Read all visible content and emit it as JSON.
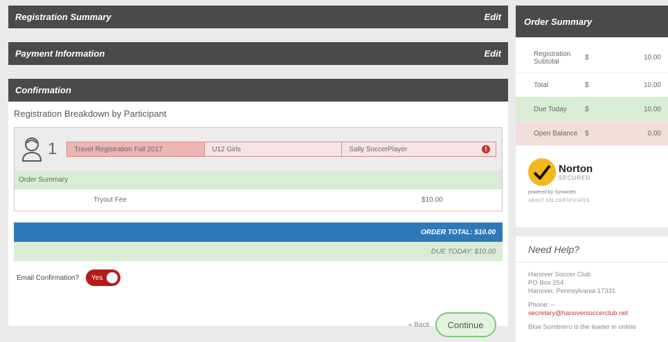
{
  "sections": {
    "registration_summary": "Registration Summary",
    "payment_information": "Payment Information",
    "confirmation": "Confirmation",
    "edit_label": "Edit"
  },
  "breakdown_title": "Registration Breakdown by Participant",
  "participant": {
    "number": "1",
    "crumbs": [
      "Travel Registration Fall 2017",
      "U12 Girls",
      "Sally SoccerPlayer"
    ],
    "order_summary_label": "Order Summary",
    "fee_name": "Tryout Fee",
    "fee_amount": "$10.00"
  },
  "order_total": "ORDER TOTAL: $10.00",
  "due_today": "DUE TODAY: $10.00",
  "email_confirmation": {
    "label": "Email Confirmation?",
    "toggle": "Yes"
  },
  "actions": {
    "back": "« Back",
    "continue": "Continue"
  },
  "order_summary": {
    "title": "Order Summary",
    "rows": [
      {
        "label": "Registration Subtotal",
        "currency": "$",
        "amount": "10.00"
      },
      {
        "label": "Total",
        "currency": "$",
        "amount": "10.00"
      },
      {
        "label": "Due Today",
        "currency": "$",
        "amount": "10.00"
      },
      {
        "label": "Open Balance",
        "currency": "$",
        "amount": "0.00"
      }
    ]
  },
  "norton": {
    "brand": "Norton",
    "secured": "SECURED",
    "powered": "powered by Symantec",
    "about": "ABOUT SSL CERTIFICATES"
  },
  "help": {
    "title": "Need Help?",
    "address": [
      "Hanover Soccer Club",
      "PO Box 254",
      "Hanover, Pennsylvania 17331"
    ],
    "phone_label": "Phone: --",
    "email": "secretary@hanoversoccerclub.net",
    "footer": "Blue Sombrero is the leader in online"
  },
  "colors": {
    "header": "#4a4a4a",
    "order_total": "#2f78b8",
    "due_today_bg": "#d9ecd5",
    "toggle": "#b51b1b",
    "continue_border": "#7cc67c"
  }
}
